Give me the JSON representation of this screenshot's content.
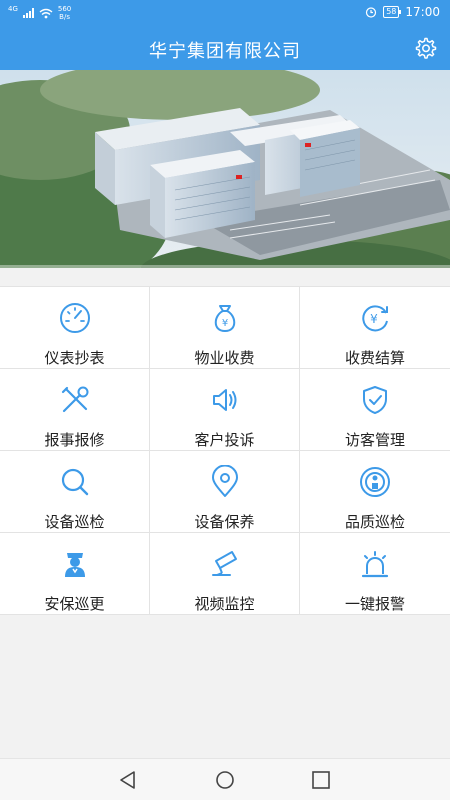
{
  "status_bar": {
    "signal": "4G",
    "speed_value": "560",
    "speed_unit": "B/s",
    "battery": "58",
    "time": "17:00"
  },
  "header": {
    "title": "华宁集团有限公司",
    "settings_icon": "gear-icon"
  },
  "banner": {
    "image": "aerial-view-of-company-campus"
  },
  "menu": [
    {
      "label": "仪表抄表",
      "icon": "gauge-icon"
    },
    {
      "label": "物业收费",
      "icon": "money-bag-icon"
    },
    {
      "label": "收费结算",
      "icon": "yen-refresh-icon"
    },
    {
      "label": "报事报修",
      "icon": "tools-icon"
    },
    {
      "label": "客户投诉",
      "icon": "speaker-icon"
    },
    {
      "label": "访客管理",
      "icon": "shield-check-icon"
    },
    {
      "label": "设备巡检",
      "icon": "magnifier-icon"
    },
    {
      "label": "设备保养",
      "icon": "location-pin-icon"
    },
    {
      "label": "品质巡检",
      "icon": "broadcast-person-icon"
    },
    {
      "label": "安保巡更",
      "icon": "security-guard-icon"
    },
    {
      "label": "视频监控",
      "icon": "camera-icon"
    },
    {
      "label": "一键报警",
      "icon": "alarm-light-icon"
    }
  ],
  "colors": {
    "primary": "#3d9ae8",
    "icon": "#3d9ae8",
    "text": "#222222",
    "background": "#f2f2f2"
  }
}
